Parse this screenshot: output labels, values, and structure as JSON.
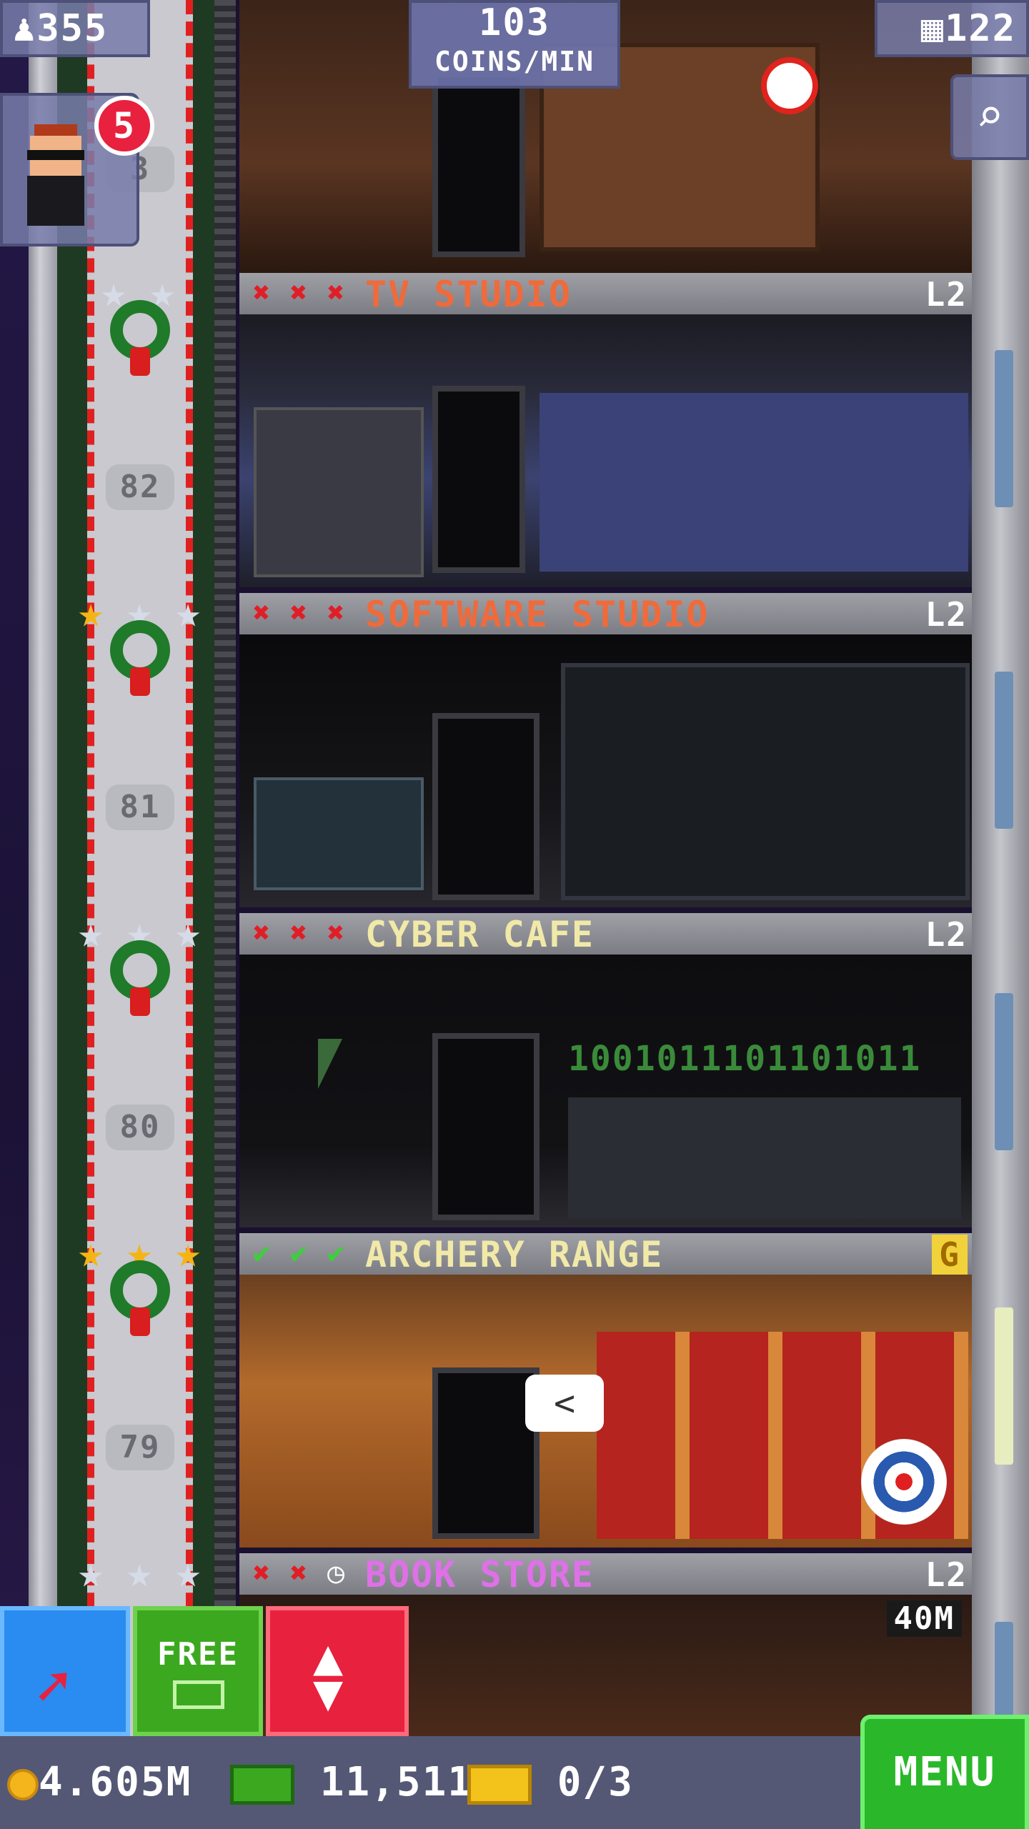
{
  "top_hud": {
    "population": "355",
    "coins_rate_value": "103",
    "coins_rate_unit": "COINS/MIN",
    "floors_count": "122"
  },
  "vip": {
    "badge_count": "5"
  },
  "elevator": {
    "floor_numbers": [
      "3",
      "82",
      "81",
      "80",
      "79"
    ]
  },
  "floors": [
    {
      "name": "TV STUDIO",
      "level": "L2",
      "name_color": "#f06a3a",
      "status": [
        "x",
        "x",
        "x"
      ]
    },
    {
      "name": "SOFTWARE STUDIO",
      "level": "L2",
      "name_color": "#f06a3a",
      "status": [
        "x",
        "x",
        "x"
      ]
    },
    {
      "name": "CYBER CAFE",
      "level": "L2",
      "name_color": "#f1e9a8",
      "status": [
        "x",
        "x",
        "x"
      ]
    },
    {
      "name": "ARCHERY RANGE",
      "level": "G",
      "name_color": "#f1e9a8",
      "status": [
        "check",
        "check",
        "check"
      ]
    },
    {
      "name": "BOOK STORE",
      "level": "L2",
      "name_color": "#e070e8",
      "status": [
        "x",
        "x",
        "clock"
      ]
    }
  ],
  "cyber_cafe_binary": "1001011101101011",
  "speech_bubble_icon": "<",
  "book_store_timer": "40M",
  "toolbar": {
    "free_label": "FREE",
    "menu_label": "MENU"
  },
  "currency": {
    "coins": "4.605M",
    "bux": "11,511",
    "tickets": "0/3"
  },
  "colors": {
    "accent_green": "#3ca820",
    "accent_red": "#e8213f",
    "accent_blue": "#2a8cf0",
    "coin_gold": "#f3b51b"
  }
}
